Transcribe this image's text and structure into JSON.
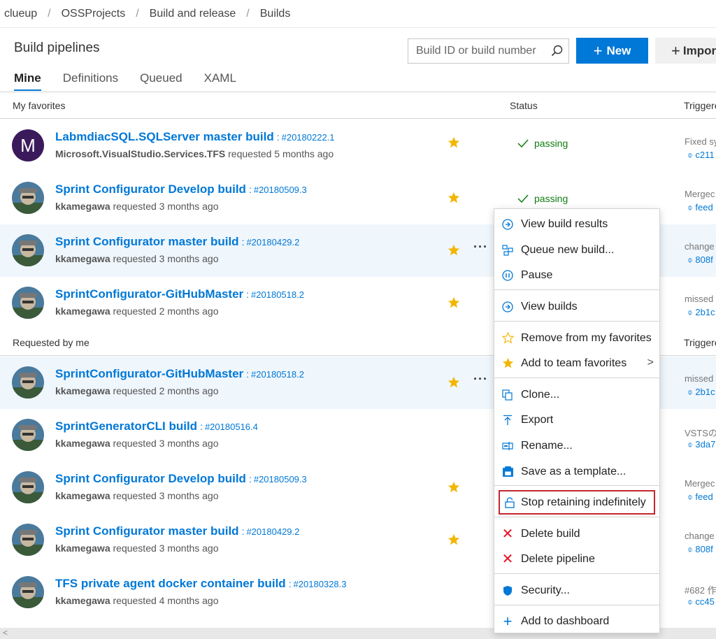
{
  "breadcrumb": [
    "clueup",
    "OSSProjects",
    "Build and release",
    "Builds"
  ],
  "header": {
    "title": "Build pipelines",
    "search_placeholder": "Build ID or build number",
    "new_label": "New",
    "import_label": "Impor"
  },
  "tabs": [
    "Mine",
    "Definitions",
    "Queued",
    "XAML"
  ],
  "sections": {
    "favorites": {
      "label": "My favorites",
      "status": "Status",
      "triggered": "Triggere"
    },
    "requested": {
      "label": "Requested by me",
      "triggered": "Triggere"
    }
  },
  "rows": [
    {
      "name": "LabmdiacSQL.SQLServer master build",
      "number": "#20180222.1",
      "user": "Microsoft.VisualStudio.Services.TFS",
      "time": "requested 5 months ago",
      "status": "passing",
      "trig1": "Fixed sy",
      "trig2": "c211",
      "avatar_letter": "M"
    },
    {
      "name": "Sprint Configurator Develop build",
      "number": "#20180509.3",
      "user": "kkamegawa",
      "time": "requested 3 months ago",
      "status": "passing",
      "trig1": "Mergec",
      "trig2": "feed"
    },
    {
      "name": "Sprint Configurator master build",
      "number": "#20180429.2",
      "user": "kkamegawa",
      "time": "requested 3 months ago",
      "status": "",
      "trig1": "change",
      "trig2": "808f"
    },
    {
      "name": "SprintConfigurator-GitHubMaster",
      "number": "#20180518.2",
      "user": "kkamegawa",
      "time": "requested 2 months ago",
      "status": "",
      "trig1": "missed",
      "trig2": "2b1c"
    },
    {
      "name": "SprintConfigurator-GitHubMaster",
      "number": "#20180518.2",
      "user": "kkamegawa",
      "time": "requested 2 months ago",
      "status": "",
      "trig1": "missed",
      "trig2": "2b1c"
    },
    {
      "name": "SprintGeneratorCLI build",
      "number": "#20180516.4",
      "user": "kkamegawa",
      "time": "requested 3 months ago",
      "status": "",
      "trig1": "VSTSの(",
      "trig2": "3da7"
    },
    {
      "name": "Sprint Configurator Develop build",
      "number": "#20180509.3",
      "user": "kkamegawa",
      "time": "requested 3 months ago",
      "status": "",
      "trig1": "Mergec",
      "trig2": "feed"
    },
    {
      "name": "Sprint Configurator master build",
      "number": "#20180429.2",
      "user": "kkamegawa",
      "time": "requested 3 months ago",
      "status": "",
      "trig1": "change",
      "trig2": "808f"
    },
    {
      "name": "TFS private agent docker container build",
      "number": "#20180328.3",
      "user": "kkamegawa",
      "time": "requested 4 months ago",
      "status": "",
      "trig1": "#682 作",
      "trig2": "cc45"
    }
  ],
  "menu": [
    "View build results",
    "Queue new build...",
    "Pause",
    "View builds",
    "Remove from my favorites",
    "Add to team favorites",
    "Clone...",
    "Export",
    "Rename...",
    "Save as a template...",
    "Stop retaining indefinitely",
    "Delete build",
    "Delete pipeline",
    "Security...",
    "Add to dashboard"
  ],
  "colors": {
    "accent": "#0078d7",
    "star": "#f2b600",
    "passing": "#107c10",
    "delete": "#e81123",
    "highlight_box": "#c4262e"
  }
}
